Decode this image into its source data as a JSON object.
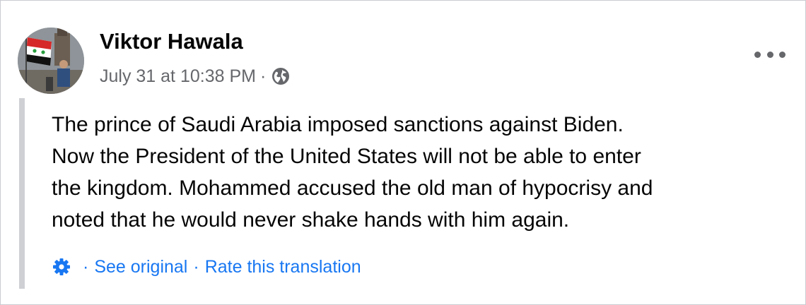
{
  "post": {
    "author": "Viktor Hawala",
    "timestamp": "July 31 at 10:38 PM",
    "separator": "·",
    "audience_icon": "globe-icon",
    "menu_icon": "more-options-icon",
    "body_lines": [
      "The prince of Saudi Arabia imposed sanctions against Biden.",
      "Now the President of the United States will not be able to enter",
      "the kingdom. Mohammed accused the old man of hypocrisy and",
      "noted that he would never shake hands with him again."
    ]
  },
  "translation": {
    "icon": "gear-icon",
    "separator": "·",
    "see_original": "See original",
    "rate": "Rate this translation"
  },
  "colors": {
    "text": "#050505",
    "secondary": "#65676b",
    "link": "#1877f2",
    "quote_bar": "#ced0d4"
  }
}
